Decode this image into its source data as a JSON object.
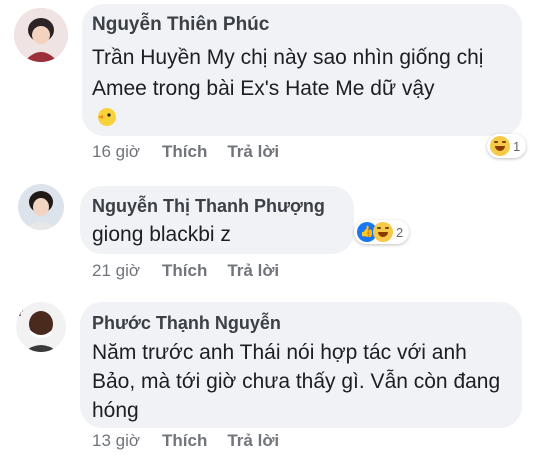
{
  "comments": [
    {
      "author": "Nguyễn Thiên Phúc",
      "text": "Trần Huyền My chị này sao nhìn giống chị Amee trong bài Ex's Hate Me dữ vậy",
      "time": "16 giờ",
      "like_label": "Thích",
      "reply_label": "Trả lời",
      "reaction_count": "1",
      "reaction_icons": [
        "haha-icon"
      ]
    },
    {
      "author": "Nguyễn Thị Thanh Phượng",
      "text": "giong blackbi z",
      "time": "21 giờ",
      "like_label": "Thích",
      "reply_label": "Trả lời",
      "reaction_count": "2",
      "reaction_icons": [
        "like-icon",
        "haha-icon"
      ]
    },
    {
      "author": "Phước Thạnh Nguyễn",
      "text": "Năm trước anh Thái nói hợp tác với anh Bảo,  mà tới giờ chưa thấy gì.  Vẫn còn đang hóng",
      "time": "13 giờ",
      "like_label": "Thích",
      "reply_label": "Trả lời"
    }
  ],
  "colors": {
    "bubble": "#f0f2f5",
    "author": "#3b3f46",
    "meta": "#71757b",
    "like_blue": "#1877f2",
    "haha_yellow": "#f7c948"
  }
}
